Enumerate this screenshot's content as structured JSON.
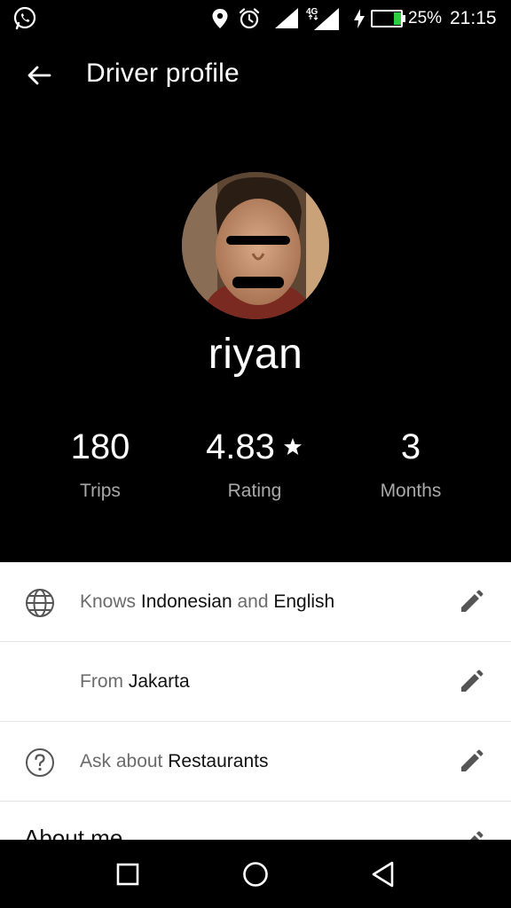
{
  "status_bar": {
    "network": "4G",
    "battery": "25%",
    "time": "21:15",
    "icons": [
      "whatsapp-icon",
      "location-icon",
      "alarm-icon",
      "signal-icon",
      "charging-icon",
      "battery-icon"
    ]
  },
  "header": {
    "title": "Driver profile",
    "back_icon": "arrow-left-icon"
  },
  "profile": {
    "name": "riyan",
    "stats": [
      {
        "value": "180",
        "label": "Trips"
      },
      {
        "value": "4.83",
        "label": "Rating",
        "icon": "star-icon"
      },
      {
        "value": "3",
        "label": "Months"
      }
    ]
  },
  "info_rows": [
    {
      "icon": "globe-icon",
      "prefix": "Knows ",
      "part1": "Indonesian",
      "middle": " and ",
      "part2": "English",
      "edit_icon": "pencil-icon"
    },
    {
      "prefix": "From ",
      "part1": "Jakarta",
      "edit_icon": "pencil-icon"
    },
    {
      "icon": "question-circle-icon",
      "prefix": "Ask about ",
      "part1": "Restaurants",
      "edit_icon": "pencil-icon"
    }
  ],
  "about": {
    "label": "About me"
  },
  "nav_bar": {
    "icons": [
      "recent-apps-icon",
      "home-icon",
      "back-triangle-icon"
    ]
  },
  "colors": {
    "background": "#000000",
    "panel": "#ffffff",
    "muted_text": "#6b6b6b",
    "stat_label": "#a9a9a9",
    "battery_green": "#2ecc40"
  }
}
